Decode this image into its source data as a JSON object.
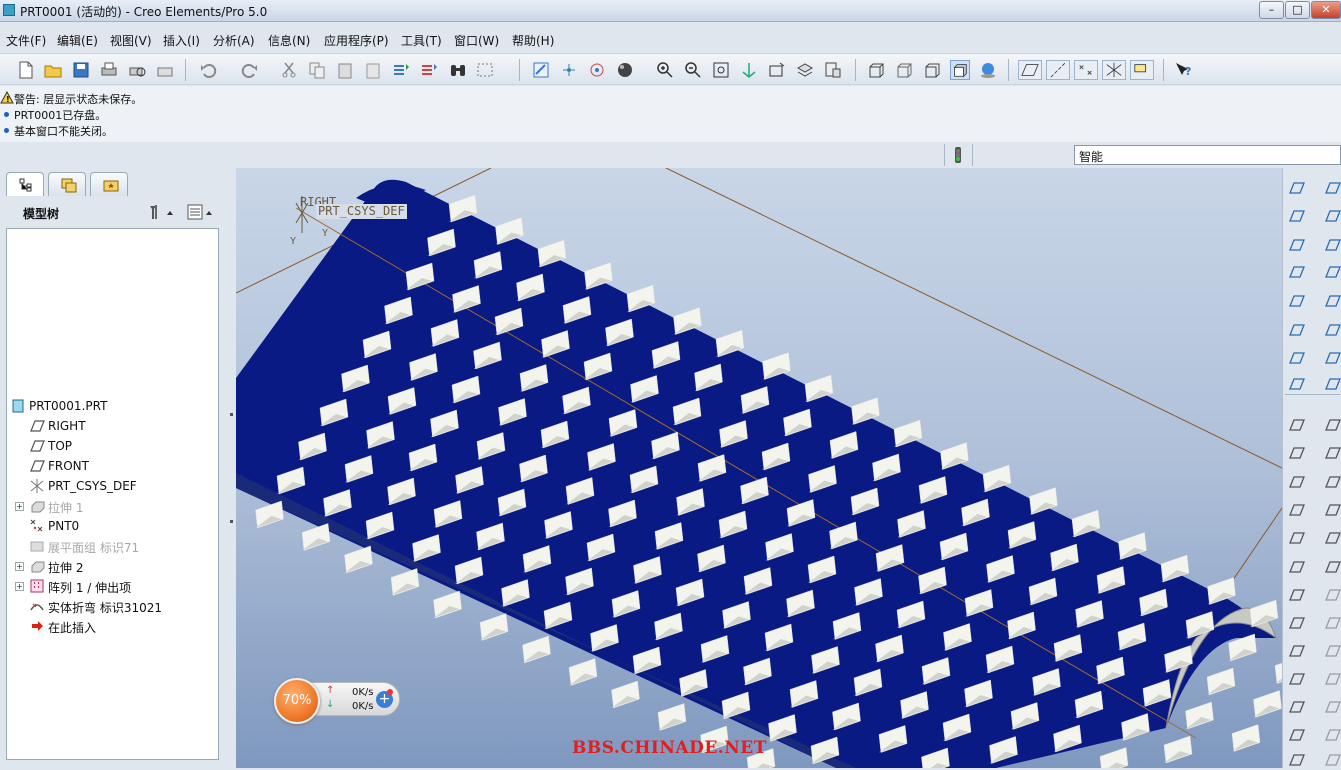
{
  "window": {
    "title": "PRT0001 (活动的) - Creo Elements/Pro 5.0"
  },
  "menu": [
    "文件(F)",
    "编辑(E)",
    "视图(V)",
    "插入(I)",
    "分析(A)",
    "信息(N)",
    "应用程序(P)",
    "工具(T)",
    "窗口(W)",
    "帮助(H)"
  ],
  "messages": [
    {
      "type": "warning",
      "text": "警告: 层显示状态未保存。"
    },
    {
      "type": "info",
      "text": "PRT0001已存盘。"
    },
    {
      "type": "info",
      "text": "基本窗口不能关闭。"
    }
  ],
  "filter": {
    "value": "智能"
  },
  "model_tree": {
    "title": "模型树",
    "items": [
      {
        "label": "PRT0001.PRT",
        "icon": "part-icon",
        "dim": false,
        "expand": false
      },
      {
        "label": "RIGHT",
        "icon": "datum-plane-icon",
        "dim": false,
        "expand": false
      },
      {
        "label": "TOP",
        "icon": "datum-plane-icon",
        "dim": false,
        "expand": false
      },
      {
        "label": "FRONT",
        "icon": "datum-plane-icon",
        "dim": false,
        "expand": false
      },
      {
        "label": "PRT_CSYS_DEF",
        "icon": "csys-icon",
        "dim": false,
        "expand": false
      },
      {
        "label": "拉伸 1",
        "icon": "extrude-icon",
        "dim": true,
        "expand": true
      },
      {
        "label": "PNT0",
        "icon": "datum-point-icon",
        "dim": false,
        "expand": false
      },
      {
        "label": "展平面组 标识71",
        "icon": "flatten-quilt-icon",
        "dim": true,
        "expand": false
      },
      {
        "label": "拉伸 2",
        "icon": "extrude-icon",
        "dim": false,
        "expand": true
      },
      {
        "label": "阵列 1 / 伸出项",
        "icon": "pattern-icon",
        "dim": false,
        "expand": true
      },
      {
        "label": "实体折弯 标识31021",
        "icon": "toroidal-bend-icon",
        "dim": false,
        "expand": false
      },
      {
        "label": "在此插入",
        "icon": "insert-here-arrow-icon",
        "dim": false,
        "expand": false
      }
    ]
  },
  "viewport": {
    "csys_labels": [
      "RIGHT",
      "PRT_CSYS_DEF",
      "Y",
      "Y"
    ]
  },
  "net_widget": {
    "percent": "70%",
    "up": "0K/s",
    "down": "0K/s"
  },
  "watermark": "BBS.CHINADE.NET",
  "colors": {
    "part_blue": "#0a1a84",
    "bump_white": "#f4f4ee",
    "accent_orange": "#f07a2a"
  }
}
